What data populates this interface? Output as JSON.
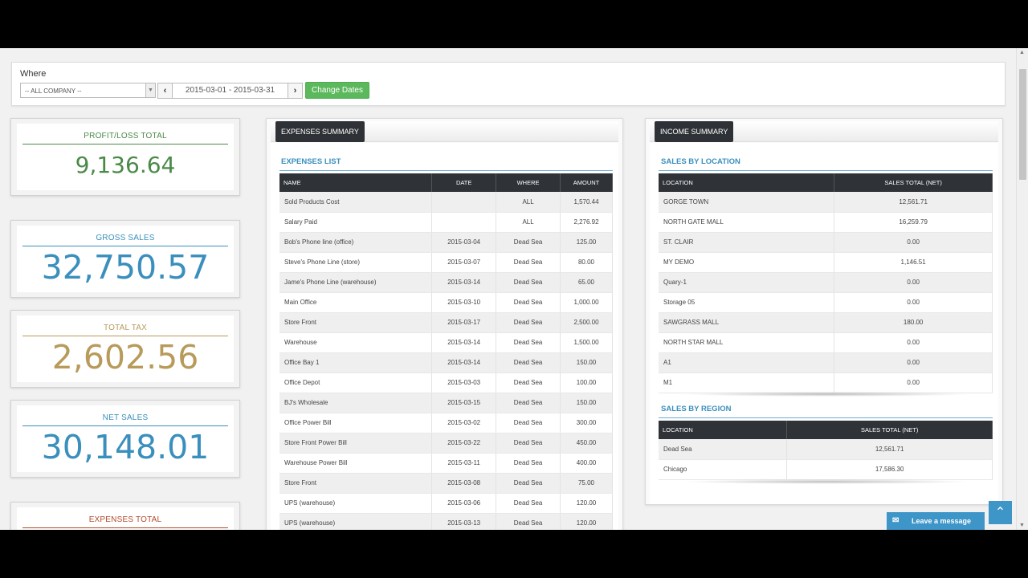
{
  "filter": {
    "where_label": "Where",
    "company_value": "-- ALL COMPANY --",
    "date_range": "2015-03-01 - 2015-03-31",
    "change_dates_label": "Change Dates"
  },
  "stats": [
    {
      "label": "PROFIT/LOSS TOTAL",
      "value": "9,136.64",
      "color": "#4a8a47"
    },
    {
      "label": "GROSS SALES",
      "value": "32,750.57",
      "color": "#3a8fbd"
    },
    {
      "label": "TOTAL TAX",
      "value": "2,602.56",
      "color": "#b89a5a"
    },
    {
      "label": "NET SALES",
      "value": "30,148.01",
      "color": "#3a8fbd"
    },
    {
      "label": "EXPENSES TOTAL",
      "value": "",
      "color": "#b24a2a"
    }
  ],
  "expenses": {
    "tab_label": "EXPENSES SUMMARY",
    "list_title": "EXPENSES LIST",
    "columns": [
      "NAME",
      "DATE",
      "WHERE",
      "AMOUNT"
    ],
    "rows": [
      [
        "Sold Products Cost",
        "",
        "ALL",
        "1,570.44"
      ],
      [
        "Salary Paid",
        "",
        "ALL",
        "2,276.92"
      ],
      [
        "Bob's Phone line (office)",
        "2015-03-04",
        "Dead Sea",
        "125.00"
      ],
      [
        "Steve's Phone Line (store)",
        "2015-03-07",
        "Dead Sea",
        "80.00"
      ],
      [
        "Jame's Phone Line (warehouse)",
        "2015-03-14",
        "Dead Sea",
        "65.00"
      ],
      [
        "Main Office",
        "2015-03-10",
        "Dead Sea",
        "1,000.00"
      ],
      [
        "Store Front",
        "2015-03-17",
        "Dead Sea",
        "2,500.00"
      ],
      [
        "Warehouse",
        "2015-03-14",
        "Dead Sea",
        "1,500.00"
      ],
      [
        "Office Bay 1",
        "2015-03-14",
        "Dead Sea",
        "150.00"
      ],
      [
        "Office Depot",
        "2015-03-03",
        "Dead Sea",
        "100.00"
      ],
      [
        "BJ's Wholesale",
        "2015-03-15",
        "Dead Sea",
        "150.00"
      ],
      [
        "Office Power Bill",
        "2015-03-02",
        "Dead Sea",
        "300.00"
      ],
      [
        "Store Front Power Bill",
        "2015-03-22",
        "Dead Sea",
        "450.00"
      ],
      [
        "Warehouse Power Bill",
        "2015-03-11",
        "Dead Sea",
        "400.00"
      ],
      [
        "Store Front",
        "2015-03-08",
        "Dead Sea",
        "75.00"
      ],
      [
        "UPS (warehouse)",
        "2015-03-06",
        "Dead Sea",
        "120.00"
      ],
      [
        "UPS (warehouse)",
        "2015-03-13",
        "Dead Sea",
        "120.00"
      ]
    ]
  },
  "income": {
    "tab_label": "INCOME SUMMARY",
    "location_title": "SALES BY LOCATION",
    "location_columns": [
      "LOCATION",
      "SALES TOTAL (NET)"
    ],
    "location_rows": [
      [
        "GORGE TOWN",
        "12,561.71"
      ],
      [
        "NORTH GATE MALL",
        "16,259.79"
      ],
      [
        "ST. CLAIR",
        "0.00"
      ],
      [
        "MY DEMO",
        "1,146.51"
      ],
      [
        "Quary-1",
        "0.00"
      ],
      [
        "Storage 05",
        "0.00"
      ],
      [
        "SAWGRASS MALL",
        "180.00"
      ],
      [
        "NORTH STAR MALL",
        "0.00"
      ],
      [
        "A1",
        "0.00"
      ],
      [
        "M1",
        "0.00"
      ]
    ],
    "region_title": "SALES BY REGION",
    "region_columns": [
      "LOCATION",
      "SALES TOTAL (NET)"
    ],
    "region_rows": [
      [
        "Dead Sea",
        "12,561.71"
      ],
      [
        "Chicago",
        "17,586.30"
      ]
    ]
  },
  "widgets": {
    "leave_message": "Leave a message",
    "back_to_top_icon": "chevron-up-icon",
    "mail_icon": "mail-icon"
  }
}
